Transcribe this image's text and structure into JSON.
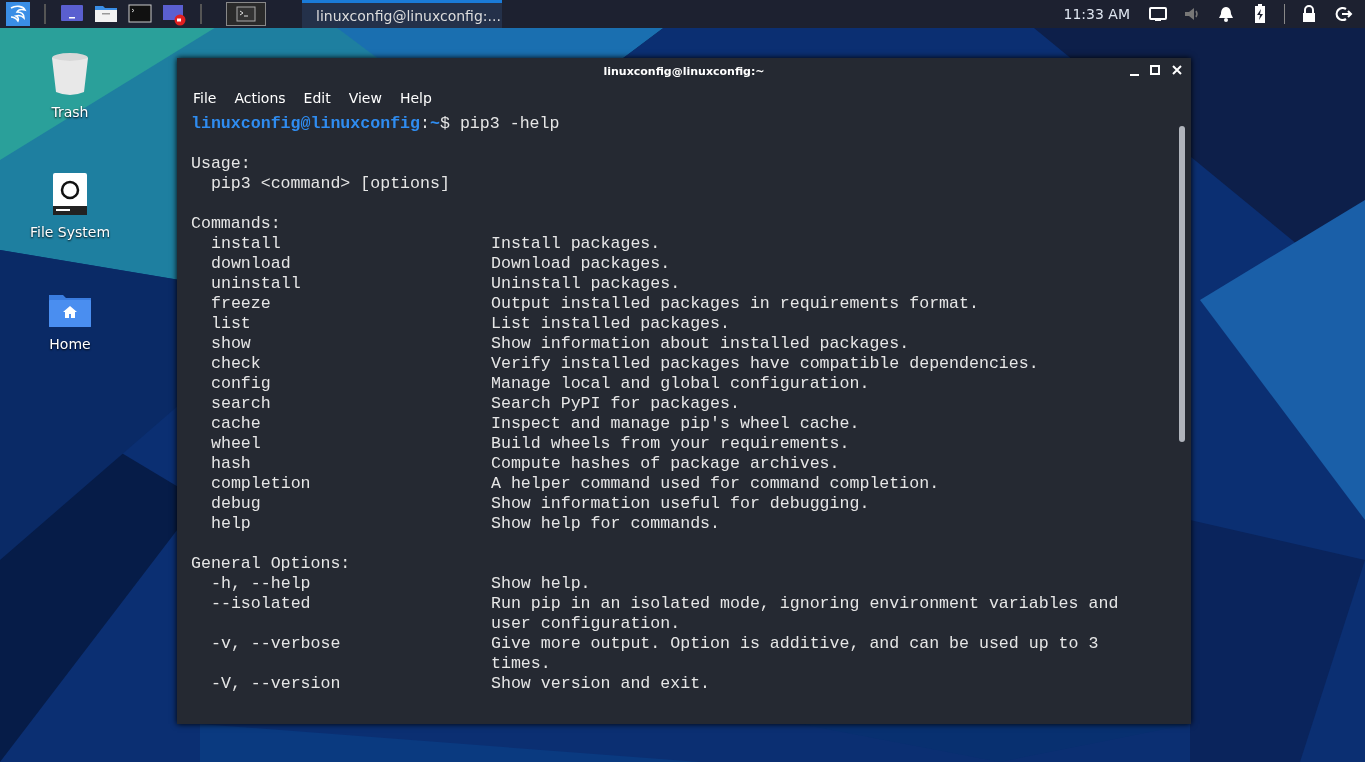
{
  "taskbar": {
    "launchers": [
      {
        "kind": "workspace"
      },
      {
        "kind": "files"
      },
      {
        "kind": "terminal"
      },
      {
        "kind": "recorder"
      }
    ],
    "workspaces": [
      {
        "selected": true
      }
    ],
    "tasks": [
      {
        "title": "linuxconfig@linuxconfig:...",
        "selected": true
      }
    ],
    "clock": "11:33 AM"
  },
  "desktop_icons": [
    {
      "kind": "trash",
      "label": "Trash"
    },
    {
      "kind": "drive",
      "label": "File System"
    },
    {
      "kind": "home",
      "label": "Home"
    }
  ],
  "window": {
    "title": "linuxconfig@linuxconfig:~",
    "menu": [
      "File",
      "Actions",
      "Edit",
      "View",
      "Help"
    ],
    "lines": [
      {
        "kind": "prompt",
        "user": "linuxconfig@linuxconfig",
        "sep": ":",
        "path": "~",
        "command": "$ pip3 -help"
      },
      {
        "kind": "blank"
      },
      {
        "kind": "text",
        "text": "Usage:"
      },
      {
        "kind": "text",
        "text": "  pip3 <command> [options]"
      },
      {
        "kind": "blank"
      },
      {
        "kind": "text",
        "text": "Commands:"
      },
      {
        "kind": "option",
        "name": "install",
        "description": "Install packages."
      },
      {
        "kind": "option",
        "name": "download",
        "description": "Download packages."
      },
      {
        "kind": "option",
        "name": "uninstall",
        "description": "Uninstall packages."
      },
      {
        "kind": "option",
        "name": "freeze",
        "description": "Output installed packages in requirements format."
      },
      {
        "kind": "option",
        "name": "list",
        "description": "List installed packages."
      },
      {
        "kind": "option",
        "name": "show",
        "description": "Show information about installed packages."
      },
      {
        "kind": "option",
        "name": "check",
        "description": "Verify installed packages have compatible dependencies."
      },
      {
        "kind": "option",
        "name": "config",
        "description": "Manage local and global configuration."
      },
      {
        "kind": "option",
        "name": "search",
        "description": "Search PyPI for packages."
      },
      {
        "kind": "option",
        "name": "cache",
        "description": "Inspect and manage pip's wheel cache."
      },
      {
        "kind": "option",
        "name": "wheel",
        "description": "Build wheels from your requirements."
      },
      {
        "kind": "option",
        "name": "hash",
        "description": "Compute hashes of package archives."
      },
      {
        "kind": "option",
        "name": "completion",
        "description": "A helper command used for command completion."
      },
      {
        "kind": "option",
        "name": "debug",
        "description": "Show information useful for debugging."
      },
      {
        "kind": "option",
        "name": "help",
        "description": "Show help for commands."
      },
      {
        "kind": "blank"
      },
      {
        "kind": "text",
        "text": "General Options:"
      },
      {
        "kind": "option",
        "name": "-h, --help",
        "description": "Show help."
      },
      {
        "kind": "option",
        "name": "--isolated",
        "description": "Run pip in an isolated mode, ignoring environment variables and"
      },
      {
        "kind": "continuation",
        "description": "user configuration."
      },
      {
        "kind": "option",
        "name": "-v, --verbose",
        "description": "Give more output. Option is additive, and can be used up to 3"
      },
      {
        "kind": "continuation",
        "description": "times."
      },
      {
        "kind": "option",
        "name": "-V, --version",
        "description": "Show version and exit."
      }
    ]
  }
}
